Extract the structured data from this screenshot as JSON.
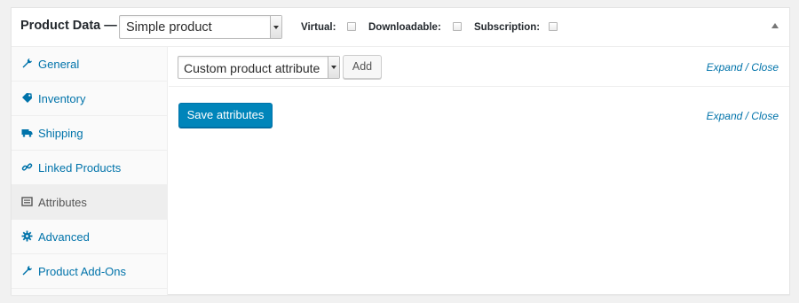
{
  "header": {
    "title": "Product Data —",
    "product_type": "Simple product",
    "virtual_label": "Virtual:",
    "downloadable_label": "Downloadable:",
    "subscription_label": "Subscription:"
  },
  "sidebar": {
    "items": [
      {
        "label": "General",
        "icon": "wrench-icon"
      },
      {
        "label": "Inventory",
        "icon": "tag-icon"
      },
      {
        "label": "Shipping",
        "icon": "truck-icon"
      },
      {
        "label": "Linked Products",
        "icon": "link-icon"
      },
      {
        "label": "Attributes",
        "icon": "list-icon",
        "active": true
      },
      {
        "label": "Advanced",
        "icon": "gear-icon"
      },
      {
        "label": "Product Add-Ons",
        "icon": "wrench-icon"
      }
    ]
  },
  "main": {
    "attribute_select": "Custom product attribute",
    "add_label": "Add",
    "expand_close": "Expand / Close",
    "save_label": "Save attributes"
  },
  "colors": {
    "accent": "#0073aa",
    "primary_button": "#0085ba"
  }
}
